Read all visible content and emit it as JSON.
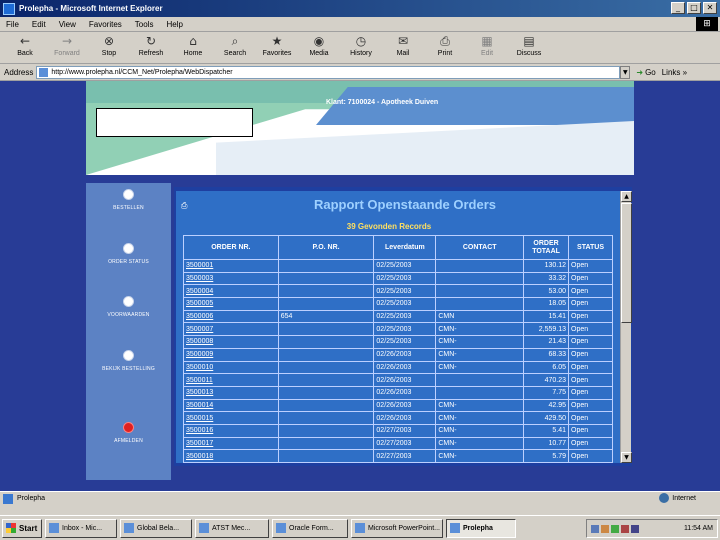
{
  "window": {
    "title": "Prolepha - Microsoft Internet Explorer",
    "min_label": "_",
    "max_label": "□",
    "close_label": "✕"
  },
  "menu": [
    "File",
    "Edit",
    "View",
    "Favorites",
    "Tools",
    "Help"
  ],
  "toolbar": [
    {
      "icon": "back-icon",
      "glyph": "←",
      "label": "Back"
    },
    {
      "icon": "forward-icon",
      "glyph": "→",
      "label": "Forward"
    },
    {
      "icon": "stop-icon",
      "glyph": "⊗",
      "label": "Stop"
    },
    {
      "icon": "refresh-icon",
      "glyph": "↻",
      "label": "Refresh"
    },
    {
      "icon": "home-icon",
      "glyph": "⌂",
      "label": "Home"
    },
    {
      "icon": "search-icon",
      "glyph": "⌕",
      "label": "Search"
    },
    {
      "icon": "favorites-icon",
      "glyph": "★",
      "label": "Favorites"
    },
    {
      "icon": "media-icon",
      "glyph": "◉",
      "label": "Media"
    },
    {
      "icon": "history-icon",
      "glyph": "◷",
      "label": "History"
    },
    {
      "icon": "mail-icon",
      "glyph": "✉",
      "label": "Mail"
    },
    {
      "icon": "print-icon",
      "glyph": "⎙",
      "label": "Print"
    },
    {
      "icon": "edit-icon",
      "glyph": "▦",
      "label": "Edit"
    },
    {
      "icon": "discuss-icon",
      "glyph": "▤",
      "label": "Discuss"
    }
  ],
  "address": {
    "label": "Address",
    "url": "http://www.prolepha.nl/CCM_Net/Prolepha/WebDispatcher",
    "go_label": "Go",
    "links_label": "Links »"
  },
  "header": {
    "klant": "Klant: 7100024 - Apotheek Duiven"
  },
  "nav": [
    {
      "label": "Bestellen",
      "active": false
    },
    {
      "label": "Order Status",
      "active": false
    },
    {
      "label": "Voorwaarden",
      "active": false
    },
    {
      "label": "Bekijk Bestelling",
      "active": false
    },
    {
      "label": "Afmelden",
      "active": true
    }
  ],
  "report": {
    "title": "Rapport Openstaande Orders",
    "subtitle": "39 Gevonden Records",
    "columns": [
      "ORDER NR.",
      "P.O. NR.",
      "Leverdatum",
      "CONTACT",
      "ORDER TOTAAL",
      "STATUS"
    ],
    "rows": [
      [
        "3500001",
        "",
        "02/25/2003",
        "",
        "130.12",
        "Open"
      ],
      [
        "3500003",
        "",
        "02/25/2003",
        "",
        "33.32",
        "Open"
      ],
      [
        "3500004",
        "",
        "02/25/2003",
        "",
        "53.00",
        "Open"
      ],
      [
        "3500005",
        "",
        "02/25/2003",
        "",
        "18.05",
        "Open"
      ],
      [
        "3500006",
        "654",
        "02/25/2003",
        "CMN",
        "15.41",
        "Open"
      ],
      [
        "3500007",
        "",
        "02/25/2003",
        "CMN-",
        "2,559.13",
        "Open"
      ],
      [
        "3500008",
        "",
        "02/25/2003",
        "CMN-",
        "21.43",
        "Open"
      ],
      [
        "3500009",
        "",
        "02/26/2003",
        "CMN-",
        "68.33",
        "Open"
      ],
      [
        "3500010",
        "",
        "02/26/2003",
        "CMN-",
        "6.05",
        "Open"
      ],
      [
        "3500011",
        "",
        "02/26/2003",
        "",
        "470.23",
        "Open"
      ],
      [
        "3500013",
        "",
        "02/26/2003",
        "",
        "7.75",
        "Open"
      ],
      [
        "3500014",
        "",
        "02/26/2003",
        "CMN-",
        "42.95",
        "Open"
      ],
      [
        "3500015",
        "",
        "02/26/2003",
        "CMN-",
        "429.50",
        "Open"
      ],
      [
        "3500016",
        "",
        "02/27/2003",
        "CMN-",
        "5.41",
        "Open"
      ],
      [
        "3500017",
        "",
        "02/27/2003",
        "CMN-",
        "10.77",
        "Open"
      ],
      [
        "3500018",
        "",
        "02/27/2003",
        "CMN-",
        "5.79",
        "Open"
      ]
    ]
  },
  "status": {
    "text": "Prolepha",
    "zone": "Internet"
  },
  "taskbar": {
    "start": "Start",
    "tasks": [
      {
        "label": "Inbox - Mic...",
        "active": false
      },
      {
        "label": "Global Bela...",
        "active": false
      },
      {
        "label": "ATST Mec...",
        "active": false
      },
      {
        "label": "Oracle Form...",
        "active": false
      },
      {
        "label": "Microsoft PowerPoint...",
        "active": false
      },
      {
        "label": "Prolepha",
        "active": true
      }
    ],
    "clock": "11:54 AM"
  }
}
